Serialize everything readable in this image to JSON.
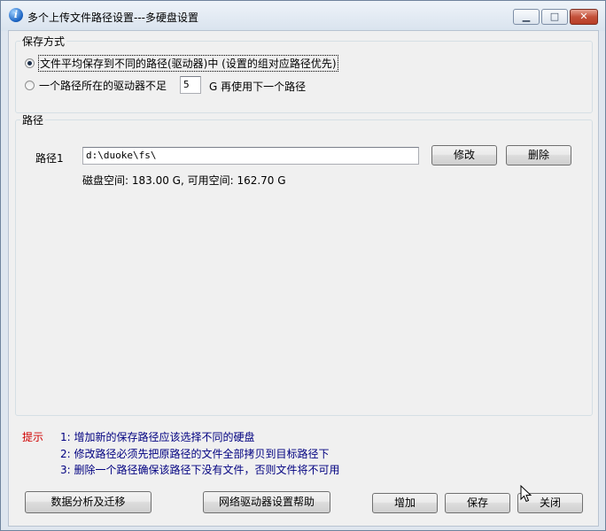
{
  "window": {
    "title": "多个上传文件路径设置---多硬盘设置",
    "minimize_glyph": "▁",
    "maximize_glyph": "□",
    "close_glyph": "✕"
  },
  "save_mode": {
    "group_label": "保存方式",
    "option1_label": "文件平均保存到不同的路径(驱动器)中  (设置的组对应路径优先)",
    "option1_selected": true,
    "option2_prefix": "一个路径所在的驱动器不足",
    "option2_value": "5",
    "option2_suffix": "G 再使用下一个路径"
  },
  "paths": {
    "group_label": "路径",
    "items": [
      {
        "label": "路径1",
        "value": "d:\\duoke\\fs\\",
        "edit_label": "修改",
        "delete_label": "删除",
        "disk_info": "磁盘空间: 183.00 G, 可用空间: 162.70 G"
      }
    ]
  },
  "tips": {
    "label": "提示",
    "lines": [
      "1: 增加新的保存路径应该选择不同的硬盘",
      "2: 修改路径必须先把原路径的文件全部拷贝到目标路径下",
      "3: 删除一个路径确保该路径下没有文件，否则文件将不可用"
    ]
  },
  "buttons": {
    "data_analysis": "数据分析及迁移",
    "network_help": "网络驱动器设置帮助",
    "add": "增加",
    "save": "保存",
    "close": "关闭"
  },
  "colors": {
    "tip_label": "#d00000",
    "tip_text": "#000080",
    "title_bar": "#dfe6ef"
  }
}
